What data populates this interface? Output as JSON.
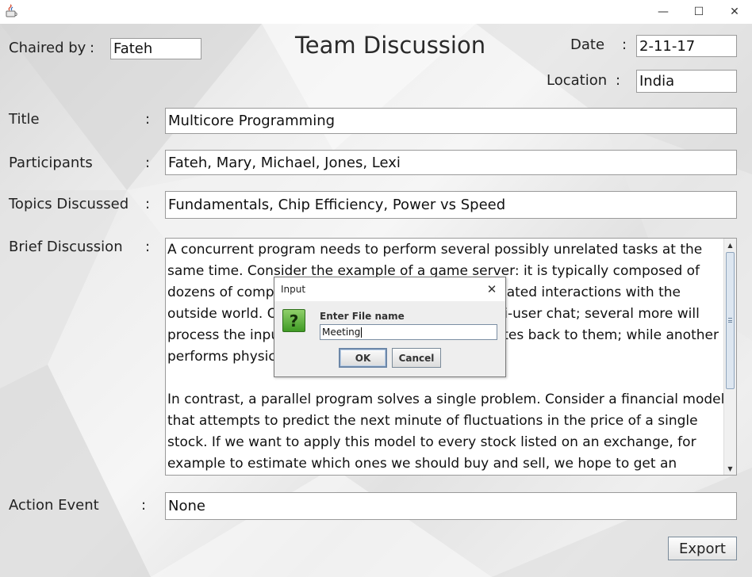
{
  "window": {
    "minimize_glyph": "—",
    "maximize_glyph": "☐",
    "close_glyph": "✕",
    "app_icon": "java-icon"
  },
  "form": {
    "heading": "Team Discussion",
    "separator": ":",
    "chaired_by": {
      "label": "Chaired by",
      "value": "Fateh"
    },
    "date": {
      "label": "Date",
      "value": "2-11-17"
    },
    "location": {
      "label": "Location",
      "value": "India"
    },
    "title": {
      "label": "Title",
      "value": "Multicore Programming"
    },
    "participants": {
      "label": "Participants",
      "value": "Fateh, Mary, Michael, Jones, Lexi"
    },
    "topics": {
      "label": "Topics Discussed",
      "value": "Fundamentals, Chip Efficiency, Power vs Speed"
    },
    "brief": {
      "label": "Brief Discussion",
      "lines_p1": [
        "A concurrent program needs to perform several possibly unrelated tasks at the",
        "same time. Consider the example of a game server: it is typically composed of",
        "dozens of components, each of which has complicated interactions with the",
        "outside world. One component might handle multi-user chat; several more will",
        "process the inputs of players and feed state updates back to them; while another",
        "performs physics calculations."
      ],
      "lines_p2": [
        "In contrast, a parallel program solves a single problem. Consider a financial model",
        "that attempts to predict the next minute of fluctuations in the price of a single",
        "stock. If we want to apply this model to every stock listed on an exchange, for",
        "example to estimate which ones we should buy and sell, we hope to get an"
      ]
    },
    "action_event": {
      "label": "Action Event",
      "value": "None"
    },
    "export_label": "Export"
  },
  "dialog": {
    "title": "Input",
    "close_glyph": "✕",
    "icon_glyph": "?",
    "prompt": "Enter File name",
    "input_value": "Meeting",
    "ok_label": "OK",
    "cancel_label": "Cancel"
  },
  "colors": {
    "background_light": "#f6f6f6",
    "background_dark": "#d9d9d9",
    "field_border": "#9a9a9a",
    "question_icon": "#3f9a24"
  }
}
